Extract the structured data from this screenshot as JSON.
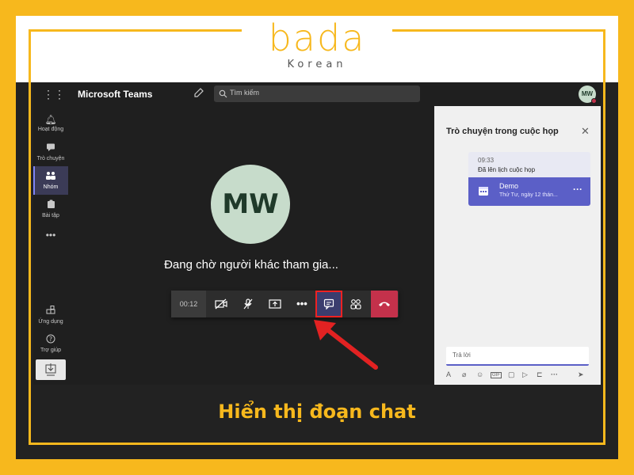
{
  "logo": {
    "main": "bada",
    "sub": "Korean"
  },
  "teams": {
    "app_title": "Microsoft Teams",
    "search_placeholder": "Tìm kiếm",
    "user_initials": "MW",
    "rail": [
      {
        "label": "Hoạt động",
        "icon": "bell-icon"
      },
      {
        "label": "Trò chuyện",
        "icon": "chat-icon"
      },
      {
        "label": "Nhóm",
        "icon": "teams-icon"
      },
      {
        "label": "Bài tập",
        "icon": "assignments-icon"
      }
    ],
    "rail_more": "•••",
    "rail_bottom": [
      {
        "label": "Ứng dụng",
        "icon": "apps-icon"
      },
      {
        "label": "Trợ giúp",
        "icon": "help-icon"
      }
    ]
  },
  "call": {
    "avatar_initials": "MW",
    "waiting_text": "Đang chờ người khác tham gia...",
    "timer": "00:12"
  },
  "chat": {
    "title": "Trò chuyện trong cuộc họp",
    "message_time": "09:33",
    "message_text": "Đã lên lịch cuộc họp",
    "event_name": "Demo",
    "event_date": "Thứ Tư, ngày 12 thán...",
    "reply_placeholder": "Trả lời"
  },
  "caption": "Hiển thị đoạn chat",
  "colors": {
    "brand_yellow": "#f7b81d",
    "teams_purple": "#5b5fc7",
    "hangup_red": "#c4314b",
    "highlight_red": "#e22222"
  }
}
